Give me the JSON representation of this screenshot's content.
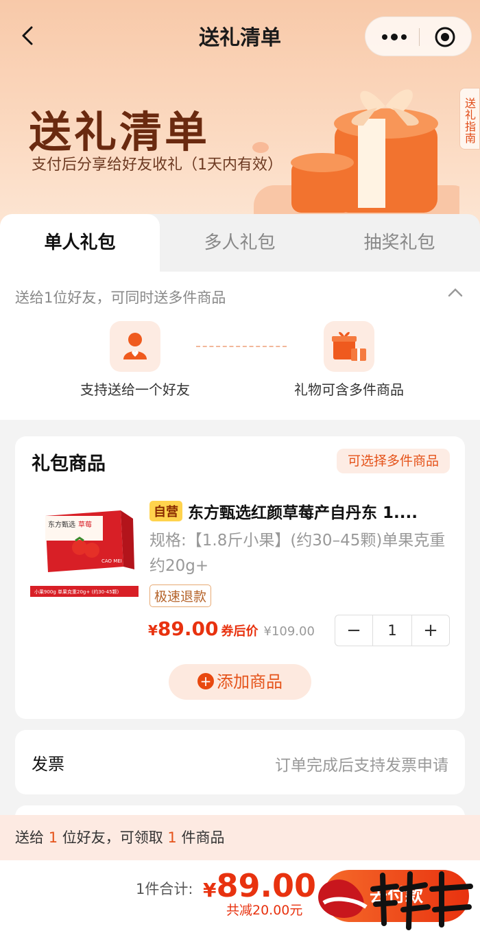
{
  "nav": {
    "title": "送礼清单"
  },
  "hero": {
    "title": "送礼清单",
    "subtitle": "支付后分享给好友收礼（1天内有效）",
    "side_guide": "送礼指南"
  },
  "tabs": [
    {
      "label": "单人礼包",
      "active": true
    },
    {
      "label": "多人礼包",
      "active": false
    },
    {
      "label": "抽奖礼包",
      "active": false
    }
  ],
  "intro": {
    "description": "送给1位好友，可同时送多件商品",
    "features": [
      {
        "icon": "friend-heart-icon",
        "label": "支持送给一个好友"
      },
      {
        "icon": "gift-boxes-icon",
        "label": "礼物可含多件商品"
      }
    ]
  },
  "gift_card": {
    "title": "礼包商品",
    "multi_tag": "可选择多件商品",
    "product": {
      "self_tag": "自营",
      "name": "东方甄选红颜草莓产自丹东 1....",
      "spec": "规格:【1.8斤小果】(约30–45颗)单果克重约20g+",
      "refund_tag": "极速退款",
      "currency": "¥",
      "price": "89.00",
      "after_coupon": "券后价",
      "original_price": "¥109.00",
      "quantity": "1",
      "box_brand": "东方甄选",
      "box_name": "草莓",
      "box_sub": "CAO MEI",
      "box_caption": "小果900g  单果克重20g+ (约30-45颗)"
    },
    "add_button": "添加商品"
  },
  "invoice": {
    "label": "发票",
    "value": "订单完成后支持发票申请"
  },
  "notice": {
    "prefix": "送给 ",
    "friends": "1",
    "middle": " 位好友，可领取 ",
    "items": "1",
    "suffix": " 件商品"
  },
  "bottom": {
    "total_label": "1件合计:",
    "currency": "¥",
    "total": "89.00",
    "discount": "共减20.00元",
    "pay_button": "去付款"
  },
  "colors": {
    "accent": "#e8320f",
    "accent_light": "#fde9df",
    "hero_bg": "#f8c9a9"
  }
}
